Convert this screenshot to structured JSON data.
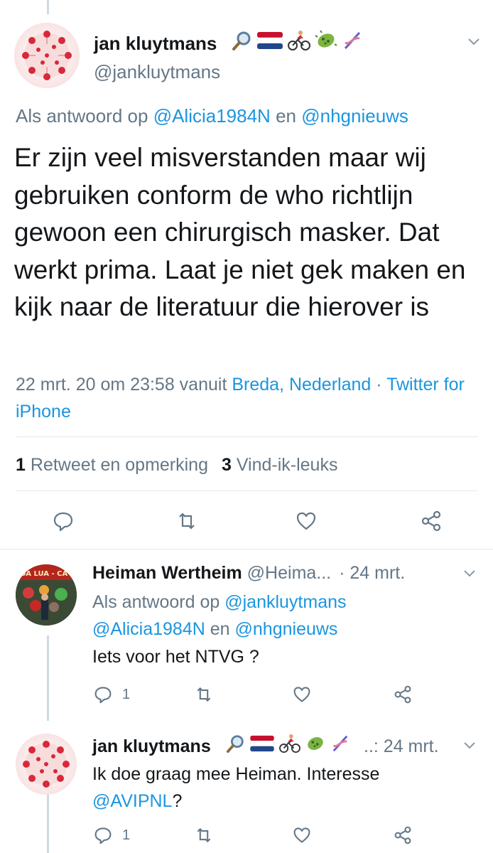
{
  "main_tweet": {
    "author_name": "jan kluytmans",
    "author_handle": "@jankluytmans",
    "reply_prefix": "Als antwoord op",
    "reply_user1": "@Alicia1984N",
    "reply_and": "en",
    "reply_user2": "@nhgnieuws",
    "text": "Er zijn veel misverstanden maar wij gebruiken conform de who richtlijn gewoon een chirurgisch masker. Dat werkt prima. Laat je niet gek maken en kijk naar de literatuur die hierover is",
    "timestamp": "22 mrt. 20 om 23:58 vanuit",
    "location": "Breda, Nederland",
    "separator": "·",
    "source": "Twitter for iPhone",
    "retweet_count": "1",
    "retweet_label": "Retweet en opmerking",
    "like_count": "3",
    "like_label": "Vind-ik-leuks"
  },
  "reply1": {
    "author_name": "Heiman Wertheim",
    "author_handle": "@Heima...",
    "time": "· 24 mrt.",
    "reply_prefix": "Als antwoord op",
    "reply_user1": "@jankluytmans",
    "reply_user2": "@Alicia1984N",
    "reply_and": "en",
    "reply_user3": "@nhgnieuws",
    "text": "Iets voor het NTVG ?",
    "avatar_text": "OA LUA - CA",
    "reply_count": "1"
  },
  "reply2": {
    "author_name": "jan kluytmans",
    "time": "..: 24 mrt.",
    "text": "Ik doe graag mee Heiman. Interesse",
    "mention": "@AVIPNL",
    "mention_suffix": "?",
    "reply_count": "1"
  },
  "icons": [
    "magnifier-icon",
    "netherlands-flag-icon",
    "cyclist-icon",
    "microbe-icon",
    "dna-icon",
    "chevron-down-icon",
    "reply-icon",
    "retweet-icon",
    "like-icon",
    "share-icon"
  ],
  "colors": {
    "link": "#1b95e0",
    "muted": "#657786",
    "text": "#14171a",
    "divider": "#e1e8ed"
  }
}
